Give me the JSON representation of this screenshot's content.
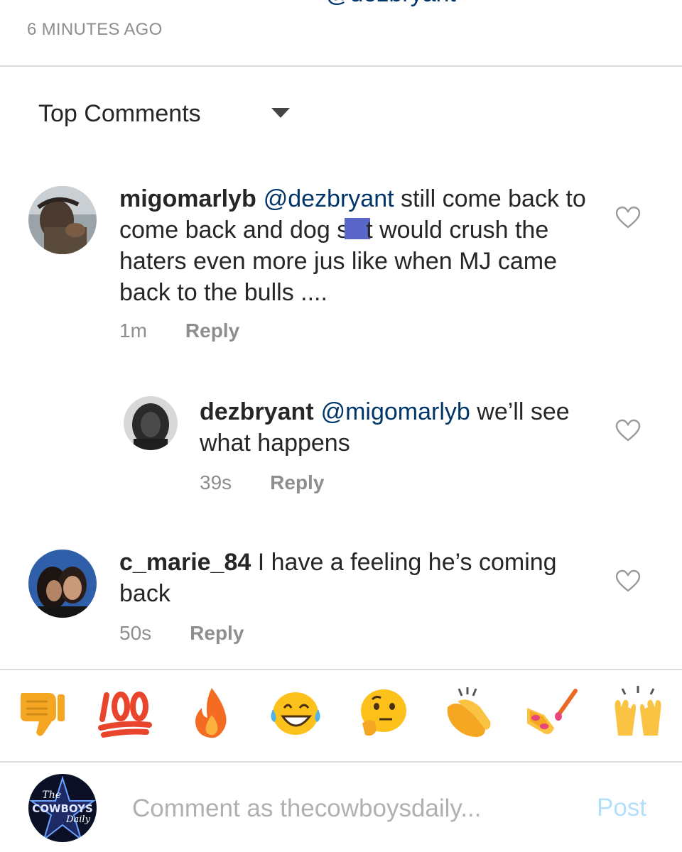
{
  "post": {
    "cutoff_caption": "@dezbryant",
    "time_ago": "6 MINUTES AGO"
  },
  "sort": {
    "label": "Top Comments"
  },
  "comments": [
    {
      "username": "migomarlyb",
      "mention": "@dezbryant",
      "text_before_censor": " still come back to come back and dog s",
      "text_after_censor": "t would crush the haters even more jus like when MJ came back to the bulls ....",
      "time": "1m",
      "reply_label": "Reply"
    },
    {
      "username": "dezbryant",
      "mention": "@migomarlyb",
      "text": " we’ll see what happens",
      "time": "39s",
      "reply_label": "Reply"
    },
    {
      "username": "c_marie_84",
      "text": " I have a feeling he’s coming back",
      "time": "50s",
      "reply_label": "Reply"
    }
  ],
  "emoji_bar": [
    {
      "name": "thumbs-down",
      "glyph": "👎"
    },
    {
      "name": "hundred-points",
      "glyph": "💯"
    },
    {
      "name": "fire",
      "glyph": "🔥"
    },
    {
      "name": "tears-of-joy",
      "glyph": "😂"
    },
    {
      "name": "thinking-face",
      "glyph": "🤔"
    },
    {
      "name": "clapping-hands",
      "glyph": "👏"
    },
    {
      "name": "nail-polish",
      "glyph": "💅"
    },
    {
      "name": "raising-hands",
      "glyph": "🙌"
    }
  ],
  "composer": {
    "placeholder": "Comment as thecowboysdaily...",
    "post_label": "Post",
    "avatar_text": [
      "The",
      "COWBOYS",
      "Daily"
    ]
  },
  "colors": {
    "mention": "#003569",
    "muted": "#8e8e8e",
    "post_disabled": "#b2dffc",
    "divider": "#dbdbdb"
  }
}
